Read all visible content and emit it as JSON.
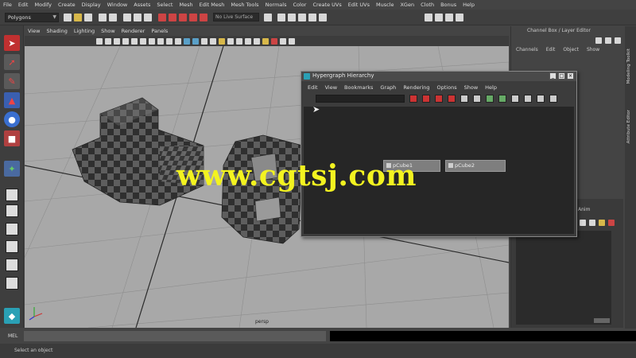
{
  "main_menu": [
    "File",
    "Edit",
    "Modify",
    "Create",
    "Display",
    "Window",
    "Assets",
    "Select",
    "Mesh",
    "Edit Mesh",
    "Mesh Tools",
    "Normals",
    "Color",
    "Create UVs",
    "Edit UVs",
    "Muscle",
    "XGen",
    "Cloth",
    "Bonus",
    "Help"
  ],
  "status_line": {
    "mode": "Polygons",
    "symmetry_field": "No Live Surface"
  },
  "viewport": {
    "menu": [
      "View",
      "Shading",
      "Lighting",
      "Show",
      "Renderer",
      "Panels"
    ],
    "camera_label": "persp"
  },
  "channel_box": {
    "title": "Channel Box / Layer Editor",
    "menu": [
      "Channels",
      "Edit",
      "Object",
      "Show"
    ]
  },
  "side_tabs": [
    "Modeling Toolkit",
    "Attribute Editor"
  ],
  "layer_editor": {
    "menu": [
      "Anim"
    ]
  },
  "hypergraph": {
    "title": "Hypergraph Hierarchy",
    "menu": [
      "Edit",
      "View",
      "Bookmarks",
      "Graph",
      "Rendering",
      "Options",
      "Show",
      "Help"
    ],
    "nodes": [
      "pCube1",
      "pCube2"
    ]
  },
  "command_line": {
    "label": "MEL"
  },
  "help_line": "Select an object",
  "watermark": "www.cgtsj.com",
  "colors": {
    "ui_background": "#444444",
    "viewport_background": "#a8a8a8",
    "accent_teal": "#2aa0b5",
    "watermark_yellow": "#f3f320"
  }
}
